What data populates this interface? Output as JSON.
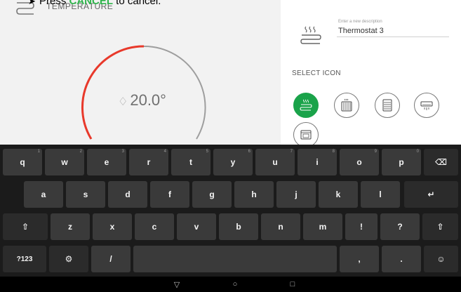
{
  "instruction": {
    "prefix": "Press ",
    "keyword": "CANCEL",
    "suffix": " to cancel."
  },
  "left": {
    "header_label": "TEMPERATURE",
    "dial_value": "20.0°",
    "colors": {
      "dial_active": "#e8392b",
      "dial_track": "#9e9e9e",
      "panel_bg": "#f2f2f2"
    }
  },
  "right": {
    "description_hint": "Enter a new description",
    "description_value": "Thermostat 3",
    "select_icon_label": "SELECT ICON",
    "icons": [
      {
        "name": "underfloor-heating-icon",
        "selected": true
      },
      {
        "name": "radiator-icon",
        "selected": false
      },
      {
        "name": "panel-heater-icon",
        "selected": false
      },
      {
        "name": "air-conditioner-icon",
        "selected": false
      },
      {
        "name": "oven-icon",
        "selected": false
      }
    ],
    "colors": {
      "selected": "#1aa34a"
    }
  },
  "keyboard": {
    "row1": [
      {
        "label": "q",
        "hint": "1"
      },
      {
        "label": "w",
        "hint": "2"
      },
      {
        "label": "e",
        "hint": "3"
      },
      {
        "label": "r",
        "hint": "4"
      },
      {
        "label": "t",
        "hint": "5"
      },
      {
        "label": "y",
        "hint": "6"
      },
      {
        "label": "u",
        "hint": "7"
      },
      {
        "label": "i",
        "hint": "8"
      },
      {
        "label": "o",
        "hint": "9"
      },
      {
        "label": "p",
        "hint": "0"
      }
    ],
    "backspace_label": "⌫",
    "row2": [
      "a",
      "s",
      "d",
      "f",
      "g",
      "h",
      "j",
      "k",
      "l"
    ],
    "enter_label": "↵",
    "row3": [
      "z",
      "x",
      "c",
      "v",
      "b",
      "n",
      "m",
      "!",
      "?"
    ],
    "shift_label": "⇧",
    "symbols_label": "?123",
    "settings_label": "⚙",
    "slash_label": "/",
    "comma_label": ",",
    "period_label": ".",
    "emoji_label": "☺"
  },
  "navbar": {
    "back_label": "▽",
    "home_label": "○",
    "recents_label": "□"
  }
}
